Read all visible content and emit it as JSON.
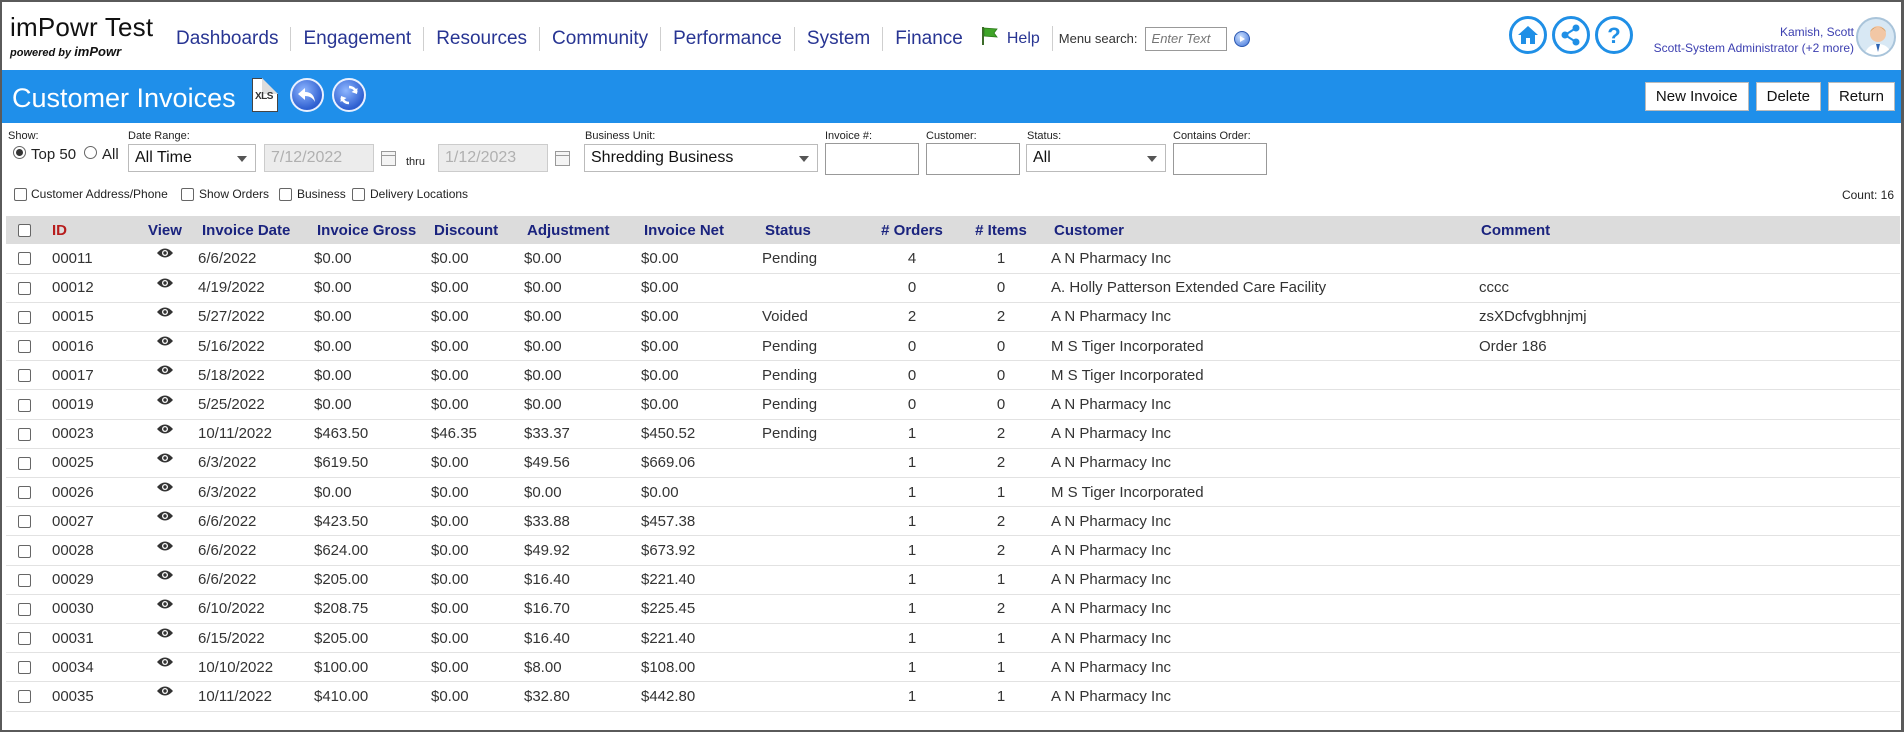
{
  "brand": {
    "app_name": "imPowr Test",
    "powered_prefix": "powered by",
    "powered_brand": "imPowr"
  },
  "nav": {
    "items": [
      "Dashboards",
      "Engagement",
      "Resources",
      "Community",
      "Performance",
      "System",
      "Finance"
    ],
    "help_label": "Help",
    "menu_search_label": "Menu search:",
    "menu_search_placeholder": "Enter Text"
  },
  "user": {
    "name": "Kamish, Scott",
    "role": "Scott-System Administrator (+2 more)"
  },
  "icons": {
    "home": "home-icon",
    "share": "share-icon",
    "help": "help-circle-icon",
    "flag": "green-flag-icon",
    "xls": "xls-export-icon",
    "back": "back-arrow-icon",
    "refresh": "refresh-icon",
    "view": "eye-icon",
    "calendar": "calendar-icon"
  },
  "colors": {
    "title_bar": "#1f8fea",
    "nav_text": "#283593",
    "id_header": "#b71c1c",
    "header_text": "#1a237e"
  },
  "page": {
    "title": "Customer Invoices",
    "buttons": {
      "new_invoice": "New Invoice",
      "delete": "Delete",
      "return": "Return"
    }
  },
  "filters": {
    "show_label": "Show:",
    "top50_label": "Top 50",
    "all_label": "All",
    "show_selected": "Top 50",
    "date_range_label": "Date Range:",
    "date_range_value": "All Time",
    "date_from": "7/12/2022",
    "thru_label": "thru",
    "date_to": "1/12/2023",
    "business_unit_label": "Business Unit:",
    "business_unit_value": "Shredding Business",
    "invoice_no_label": "Invoice #:",
    "invoice_no_value": "",
    "customer_label": "Customer:",
    "customer_value": "",
    "status_label": "Status:",
    "status_value": "All",
    "contains_order_label": "Contains Order:",
    "contains_order_value": "",
    "checkboxes": [
      "Customer Address/Phone",
      "Show Orders",
      "Business",
      "Delivery Locations"
    ],
    "count_text": "Count: 16"
  },
  "table": {
    "headers": {
      "id": "ID",
      "view": "View",
      "invoice_date": "Invoice Date",
      "invoice_gross": "Invoice Gross",
      "discount": "Discount",
      "adjustment": "Adjustment",
      "invoice_net": "Invoice Net",
      "status": "Status",
      "orders": "# Orders",
      "items": "# Items",
      "customer": "Customer",
      "comment": "Comment"
    },
    "rows": [
      {
        "id": "00011",
        "date": "6/6/2022",
        "gross": "$0.00",
        "discount": "$0.00",
        "adjustment": "$0.00",
        "net": "$0.00",
        "status": "Pending",
        "orders": "4",
        "items": "1",
        "customer": "A N Pharmacy Inc",
        "comment": ""
      },
      {
        "id": "00012",
        "date": "4/19/2022",
        "gross": "$0.00",
        "discount": "$0.00",
        "adjustment": "$0.00",
        "net": "$0.00",
        "status": "",
        "orders": "0",
        "items": "0",
        "customer": "A. Holly Patterson Extended Care Facility",
        "comment": "cccc"
      },
      {
        "id": "00015",
        "date": "5/27/2022",
        "gross": "$0.00",
        "discount": "$0.00",
        "adjustment": "$0.00",
        "net": "$0.00",
        "status": "Voided",
        "orders": "2",
        "items": "2",
        "customer": "A N Pharmacy Inc",
        "comment": "zsXDcfvgbhnjmj"
      },
      {
        "id": "00016",
        "date": "5/16/2022",
        "gross": "$0.00",
        "discount": "$0.00",
        "adjustment": "$0.00",
        "net": "$0.00",
        "status": "Pending",
        "orders": "0",
        "items": "0",
        "customer": "M S Tiger Incorporated",
        "comment": "Order 186"
      },
      {
        "id": "00017",
        "date": "5/18/2022",
        "gross": "$0.00",
        "discount": "$0.00",
        "adjustment": "$0.00",
        "net": "$0.00",
        "status": "Pending",
        "orders": "0",
        "items": "0",
        "customer": "M S Tiger Incorporated",
        "comment": ""
      },
      {
        "id": "00019",
        "date": "5/25/2022",
        "gross": "$0.00",
        "discount": "$0.00",
        "adjustment": "$0.00",
        "net": "$0.00",
        "status": "Pending",
        "orders": "0",
        "items": "0",
        "customer": "A N Pharmacy Inc",
        "comment": ""
      },
      {
        "id": "00023",
        "date": "10/11/2022",
        "gross": "$463.50",
        "discount": "$46.35",
        "adjustment": "$33.37",
        "net": "$450.52",
        "status": "Pending",
        "orders": "1",
        "items": "2",
        "customer": "A N Pharmacy Inc",
        "comment": ""
      },
      {
        "id": "00025",
        "date": "6/3/2022",
        "gross": "$619.50",
        "discount": "$0.00",
        "adjustment": "$49.56",
        "net": "$669.06",
        "status": "",
        "orders": "1",
        "items": "2",
        "customer": "A N Pharmacy Inc",
        "comment": ""
      },
      {
        "id": "00026",
        "date": "6/3/2022",
        "gross": "$0.00",
        "discount": "$0.00",
        "adjustment": "$0.00",
        "net": "$0.00",
        "status": "",
        "orders": "1",
        "items": "1",
        "customer": "M S Tiger Incorporated",
        "comment": ""
      },
      {
        "id": "00027",
        "date": "6/6/2022",
        "gross": "$423.50",
        "discount": "$0.00",
        "adjustment": "$33.88",
        "net": "$457.38",
        "status": "",
        "orders": "1",
        "items": "2",
        "customer": "A N Pharmacy Inc",
        "comment": ""
      },
      {
        "id": "00028",
        "date": "6/6/2022",
        "gross": "$624.00",
        "discount": "$0.00",
        "adjustment": "$49.92",
        "net": "$673.92",
        "status": "",
        "orders": "1",
        "items": "2",
        "customer": "A N Pharmacy Inc",
        "comment": ""
      },
      {
        "id": "00029",
        "date": "6/6/2022",
        "gross": "$205.00",
        "discount": "$0.00",
        "adjustment": "$16.40",
        "net": "$221.40",
        "status": "",
        "orders": "1",
        "items": "1",
        "customer": "A N Pharmacy Inc",
        "comment": ""
      },
      {
        "id": "00030",
        "date": "6/10/2022",
        "gross": "$208.75",
        "discount": "$0.00",
        "adjustment": "$16.70",
        "net": "$225.45",
        "status": "",
        "orders": "1",
        "items": "2",
        "customer": "A N Pharmacy Inc",
        "comment": ""
      },
      {
        "id": "00031",
        "date": "6/15/2022",
        "gross": "$205.00",
        "discount": "$0.00",
        "adjustment": "$16.40",
        "net": "$221.40",
        "status": "",
        "orders": "1",
        "items": "1",
        "customer": "A N Pharmacy Inc",
        "comment": ""
      },
      {
        "id": "00034",
        "date": "10/10/2022",
        "gross": "$100.00",
        "discount": "$0.00",
        "adjustment": "$8.00",
        "net": "$108.00",
        "status": "",
        "orders": "1",
        "items": "1",
        "customer": "A N Pharmacy Inc",
        "comment": ""
      },
      {
        "id": "00035",
        "date": "10/11/2022",
        "gross": "$410.00",
        "discount": "$0.00",
        "adjustment": "$32.80",
        "net": "$442.80",
        "status": "",
        "orders": "1",
        "items": "1",
        "customer": "A N Pharmacy Inc",
        "comment": ""
      }
    ]
  }
}
